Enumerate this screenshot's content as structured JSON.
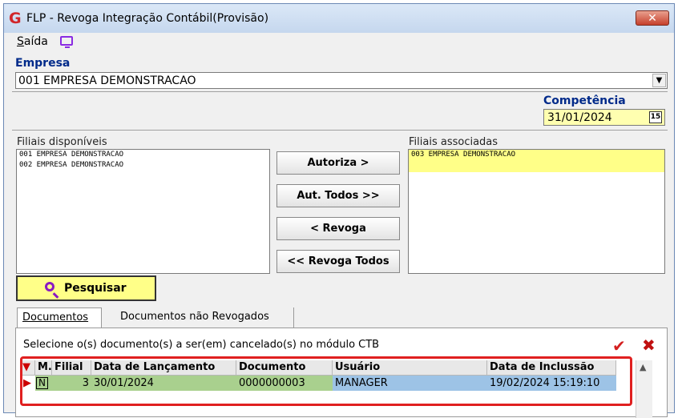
{
  "window": {
    "title": "FLP - Revoga Integração Contábil(Provisão)",
    "logo": "G",
    "close_label": "✕"
  },
  "menu": {
    "saida": "Saída",
    "saida_accel": "S",
    "saida_rest": "aída"
  },
  "empresa": {
    "label": "Empresa",
    "value": "001 EMPRESA DEMONSTRACAO"
  },
  "competencia": {
    "label": "Competência",
    "value": "31/01/2024",
    "calendar_icon_text": "15"
  },
  "filiais_disponiveis": {
    "label": "Filiais disponíveis",
    "items": [
      "001 EMPRESA DEMONSTRACAO",
      "002 EMPRESA DEMONSTRACAO"
    ]
  },
  "filiais_associadas": {
    "label": "Filiais associadas",
    "items": [
      "003 EMPRESA DEMONSTRACAO"
    ]
  },
  "buttons": {
    "autoriza": "Autoriza >",
    "aut_todos": "Aut. Todos >>",
    "revoga": "< Revoga",
    "revoga_todos": "<< Revoga Todos",
    "pesquisar": "Pesquisar"
  },
  "tabs": [
    {
      "label": "Documentos"
    },
    {
      "label": "Documentos não Revogados"
    }
  ],
  "instruction": "Selecione o(s) documento(s) a ser(em) cancelado(s) no módulo CTB",
  "grid": {
    "columns": [
      "M.",
      "Filial",
      "Data de Lançamento",
      "Documento",
      "Usuário",
      "Data de Inclussão"
    ],
    "rows": [
      {
        "m": "N",
        "filial": "3",
        "data_lancamento": "30/01/2024",
        "documento": "0000000003",
        "usuario": "MANAGER",
        "data_inclusao": "19/02/2024 15:19:10"
      }
    ]
  },
  "colors": {
    "accent_label": "#002a8a",
    "highlight_border": "#e02020",
    "field_yellow": "#ffffb0",
    "row_blue": "#9dc3e6",
    "row_green": "#a9d08e"
  },
  "icons": {
    "app": "flp-logo-icon",
    "close": "close-icon",
    "monitor": "monitor-icon",
    "dropdown": "chevron-down-icon",
    "calendar": "calendar-icon",
    "search": "search-icon",
    "confirm": "checkmark-icon",
    "cancel": "x-icon",
    "row_pointer": "row-pointer-icon",
    "sort": "sort-down-icon",
    "scroll_up": "scroll-up-icon"
  }
}
